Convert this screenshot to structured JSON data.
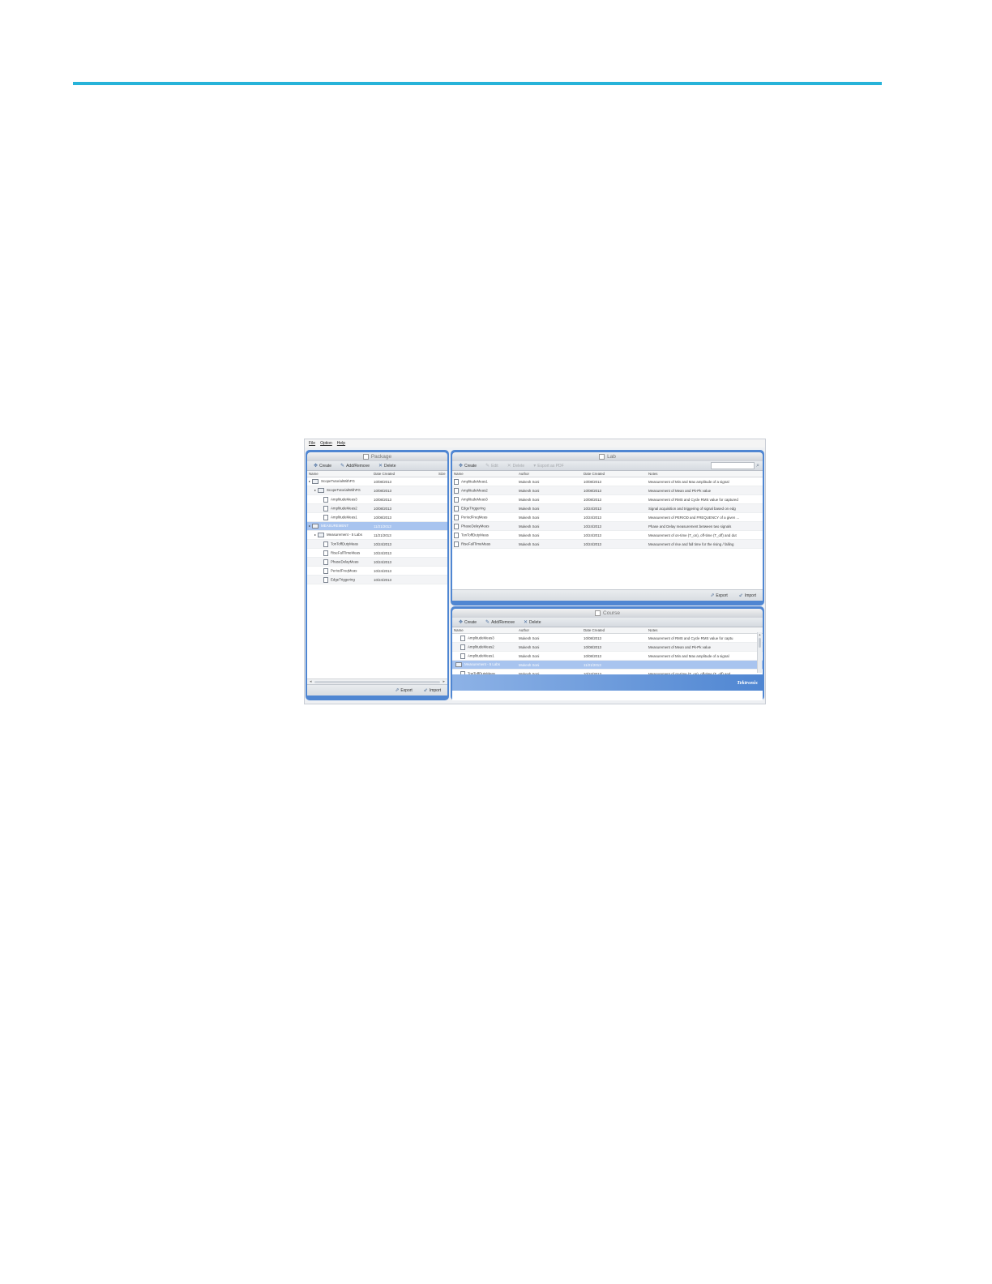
{
  "menu": [
    "File",
    "Option",
    "Help"
  ],
  "package": {
    "title": "Package",
    "toolbar": [
      "Create",
      "Add/Remove",
      "Delete"
    ],
    "columns": [
      "Name",
      "Date Created",
      "Size"
    ],
    "rows": [
      {
        "name": "ScopeTutorialWithFG",
        "date": "10/08/2013",
        "twisty": "▸",
        "icon": "folder",
        "level": 0
      },
      {
        "name": "ScopeTutorialWithFG",
        "date": "10/08/2013",
        "twisty": "▸",
        "icon": "folder",
        "level": 1
      },
      {
        "name": "AmplitudeMeas3",
        "date": "10/08/2013",
        "twisty": "",
        "icon": "doc",
        "level": 2
      },
      {
        "name": "AmplitudeMeas2",
        "date": "10/08/2013",
        "twisty": "",
        "icon": "doc",
        "level": 2
      },
      {
        "name": "AmplitudeMeas1",
        "date": "10/08/2013",
        "twisty": "",
        "icon": "doc",
        "level": 2
      },
      {
        "name": "MEASUREMENT",
        "date": "11/21/2013",
        "twisty": "▸",
        "icon": "folder",
        "level": 0,
        "selected": true
      },
      {
        "name": "Measurement - 5 Labs",
        "date": "11/21/2013",
        "twisty": "▸",
        "icon": "folder",
        "level": 1
      },
      {
        "name": "TonToffDutyMeas",
        "date": "10/24/2013",
        "twisty": "",
        "icon": "doc",
        "level": 2
      },
      {
        "name": "RiseFallTimeMeas",
        "date": "10/24/2013",
        "twisty": "",
        "icon": "doc",
        "level": 2
      },
      {
        "name": "PhaseDelayMeas",
        "date": "10/24/2013",
        "twisty": "",
        "icon": "doc",
        "level": 2
      },
      {
        "name": "PeriodFreqMeas",
        "date": "10/24/2013",
        "twisty": "",
        "icon": "doc",
        "level": 2
      },
      {
        "name": "EdgeTriggering",
        "date": "10/24/2013",
        "twisty": "",
        "icon": "doc",
        "level": 2
      }
    ],
    "export_label": "Export",
    "import_label": "Import"
  },
  "lab": {
    "title": "Lab",
    "toolbar": [
      {
        "label": "Create",
        "enabled": true
      },
      {
        "label": "Edit",
        "enabled": false
      },
      {
        "label": "Delete",
        "enabled": false
      },
      {
        "label": "Export as PDF",
        "enabled": false
      }
    ],
    "columns": [
      "Name",
      "Author",
      "Date Created",
      "Notes"
    ],
    "rows": [
      {
        "name": "AmplitudeMeas1",
        "author": "Mukesh Soni",
        "date": "10/08/2013",
        "notes": "Measurement of Min and Max amplitude of a signal"
      },
      {
        "name": "AmplitudeMeas2",
        "author": "Mukesh Soni",
        "date": "10/08/2013",
        "notes": "Measurement of Mean and Pk-Pk value"
      },
      {
        "name": "AmplitudeMeas3",
        "author": "Mukesh Soni",
        "date": "10/08/2013",
        "notes": "Measurement of RMS and Cycle RMS value for captured"
      },
      {
        "name": "EdgeTriggering",
        "author": "Mukesh Soni",
        "date": "10/24/2013",
        "notes": "Signal acquisition and triggering of signal based on edg"
      },
      {
        "name": "PeriodFreqMeas",
        "author": "Mukesh Soni",
        "date": "10/24/2013",
        "notes": "Measurement of PERIOD and FREQUENCY of a given ..."
      },
      {
        "name": "PhaseDelayMeas",
        "author": "Mukesh Soni",
        "date": "10/24/2013",
        "notes": "Phase and Delay measurement between two signals"
      },
      {
        "name": "TonToffDutyMeas",
        "author": "Mukesh Soni",
        "date": "10/24/2013",
        "notes": "Measurement of on-time (T_on), off-time (T_off) and dut"
      },
      {
        "name": "RiseFallTimeMeas",
        "author": "Mukesh Soni",
        "date": "10/24/2013",
        "notes": "Measurement of rise and fall time for the rising / falling"
      }
    ],
    "export_label": "Export",
    "import_label": "Import"
  },
  "course": {
    "title": "Course",
    "toolbar": [
      "Create",
      "Add/Remove",
      "Delete"
    ],
    "columns": [
      "Name",
      "Author",
      "Date Created",
      "Notes"
    ],
    "rows": [
      {
        "name": "AmplitudeMeas3",
        "author": "Mukesh Soni",
        "date": "10/08/2013",
        "notes": "Measurement of RMS and Cycle RMS value for captu"
      },
      {
        "name": "AmplitudeMeas2",
        "author": "Mukesh Soni",
        "date": "10/08/2013",
        "notes": "Measurement of Mean and Pk-Pk value"
      },
      {
        "name": "AmplitudeMeas1",
        "author": "Mukesh Soni",
        "date": "10/08/2013",
        "notes": "Measurement of Min and Max amplitude of a signal"
      },
      {
        "name": "Measurement - 5 Labs",
        "author": "Mukesh Soni",
        "date": "11/21/2013",
        "notes": "",
        "selected": true,
        "folder": true
      },
      {
        "name": "TonToffDutyMeas",
        "author": "Mukesh Soni",
        "date": "10/24/2013",
        "notes": "Measurement of on-time (T_on), off-time (T_off) and"
      }
    ],
    "brand": "Tektronix"
  },
  "colors": {
    "accent_bar": "#27b3d9",
    "panel_frame": "#4f86d2",
    "selection": "#a8c4ef"
  }
}
